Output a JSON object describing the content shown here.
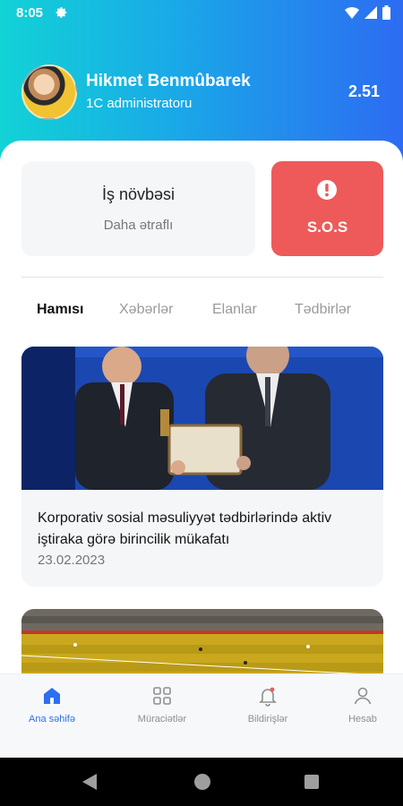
{
  "status_bar": {
    "time": "8:05"
  },
  "profile": {
    "name": "Hikmet Benmûbarek",
    "role": "1C administratoru",
    "version": "2.51"
  },
  "shift_card": {
    "title": "İş növbəsi",
    "subtitle": "Daha ətraflı"
  },
  "sos": {
    "label": "S.O.S",
    "icon": "exclamation-circle-icon"
  },
  "tabs": [
    {
      "label": "Hamısı",
      "active": true
    },
    {
      "label": "Xəbərlər",
      "active": false
    },
    {
      "label": "Elanlar",
      "active": false
    },
    {
      "label": "Tədbirlər",
      "active": false
    }
  ],
  "news": [
    {
      "title": "Korporativ sosial məsuliyyət tədbirlərində aktiv iştiraka görə birincilik mükafatı",
      "date": "23.02.2023"
    }
  ],
  "bottom_nav": [
    {
      "label": "Ana səhifə",
      "icon": "home-icon",
      "active": true
    },
    {
      "label": "Müraciətlər",
      "icon": "grid-icon",
      "active": false
    },
    {
      "label": "Bildirişlər",
      "icon": "bell-icon",
      "active": false
    },
    {
      "label": "Hesab",
      "icon": "user-icon",
      "active": false
    }
  ],
  "colors": {
    "accent": "#2b6ff3",
    "sos": "#ee5a5a",
    "gradient_start": "#12d3d6",
    "gradient_end": "#2d6cf2"
  }
}
